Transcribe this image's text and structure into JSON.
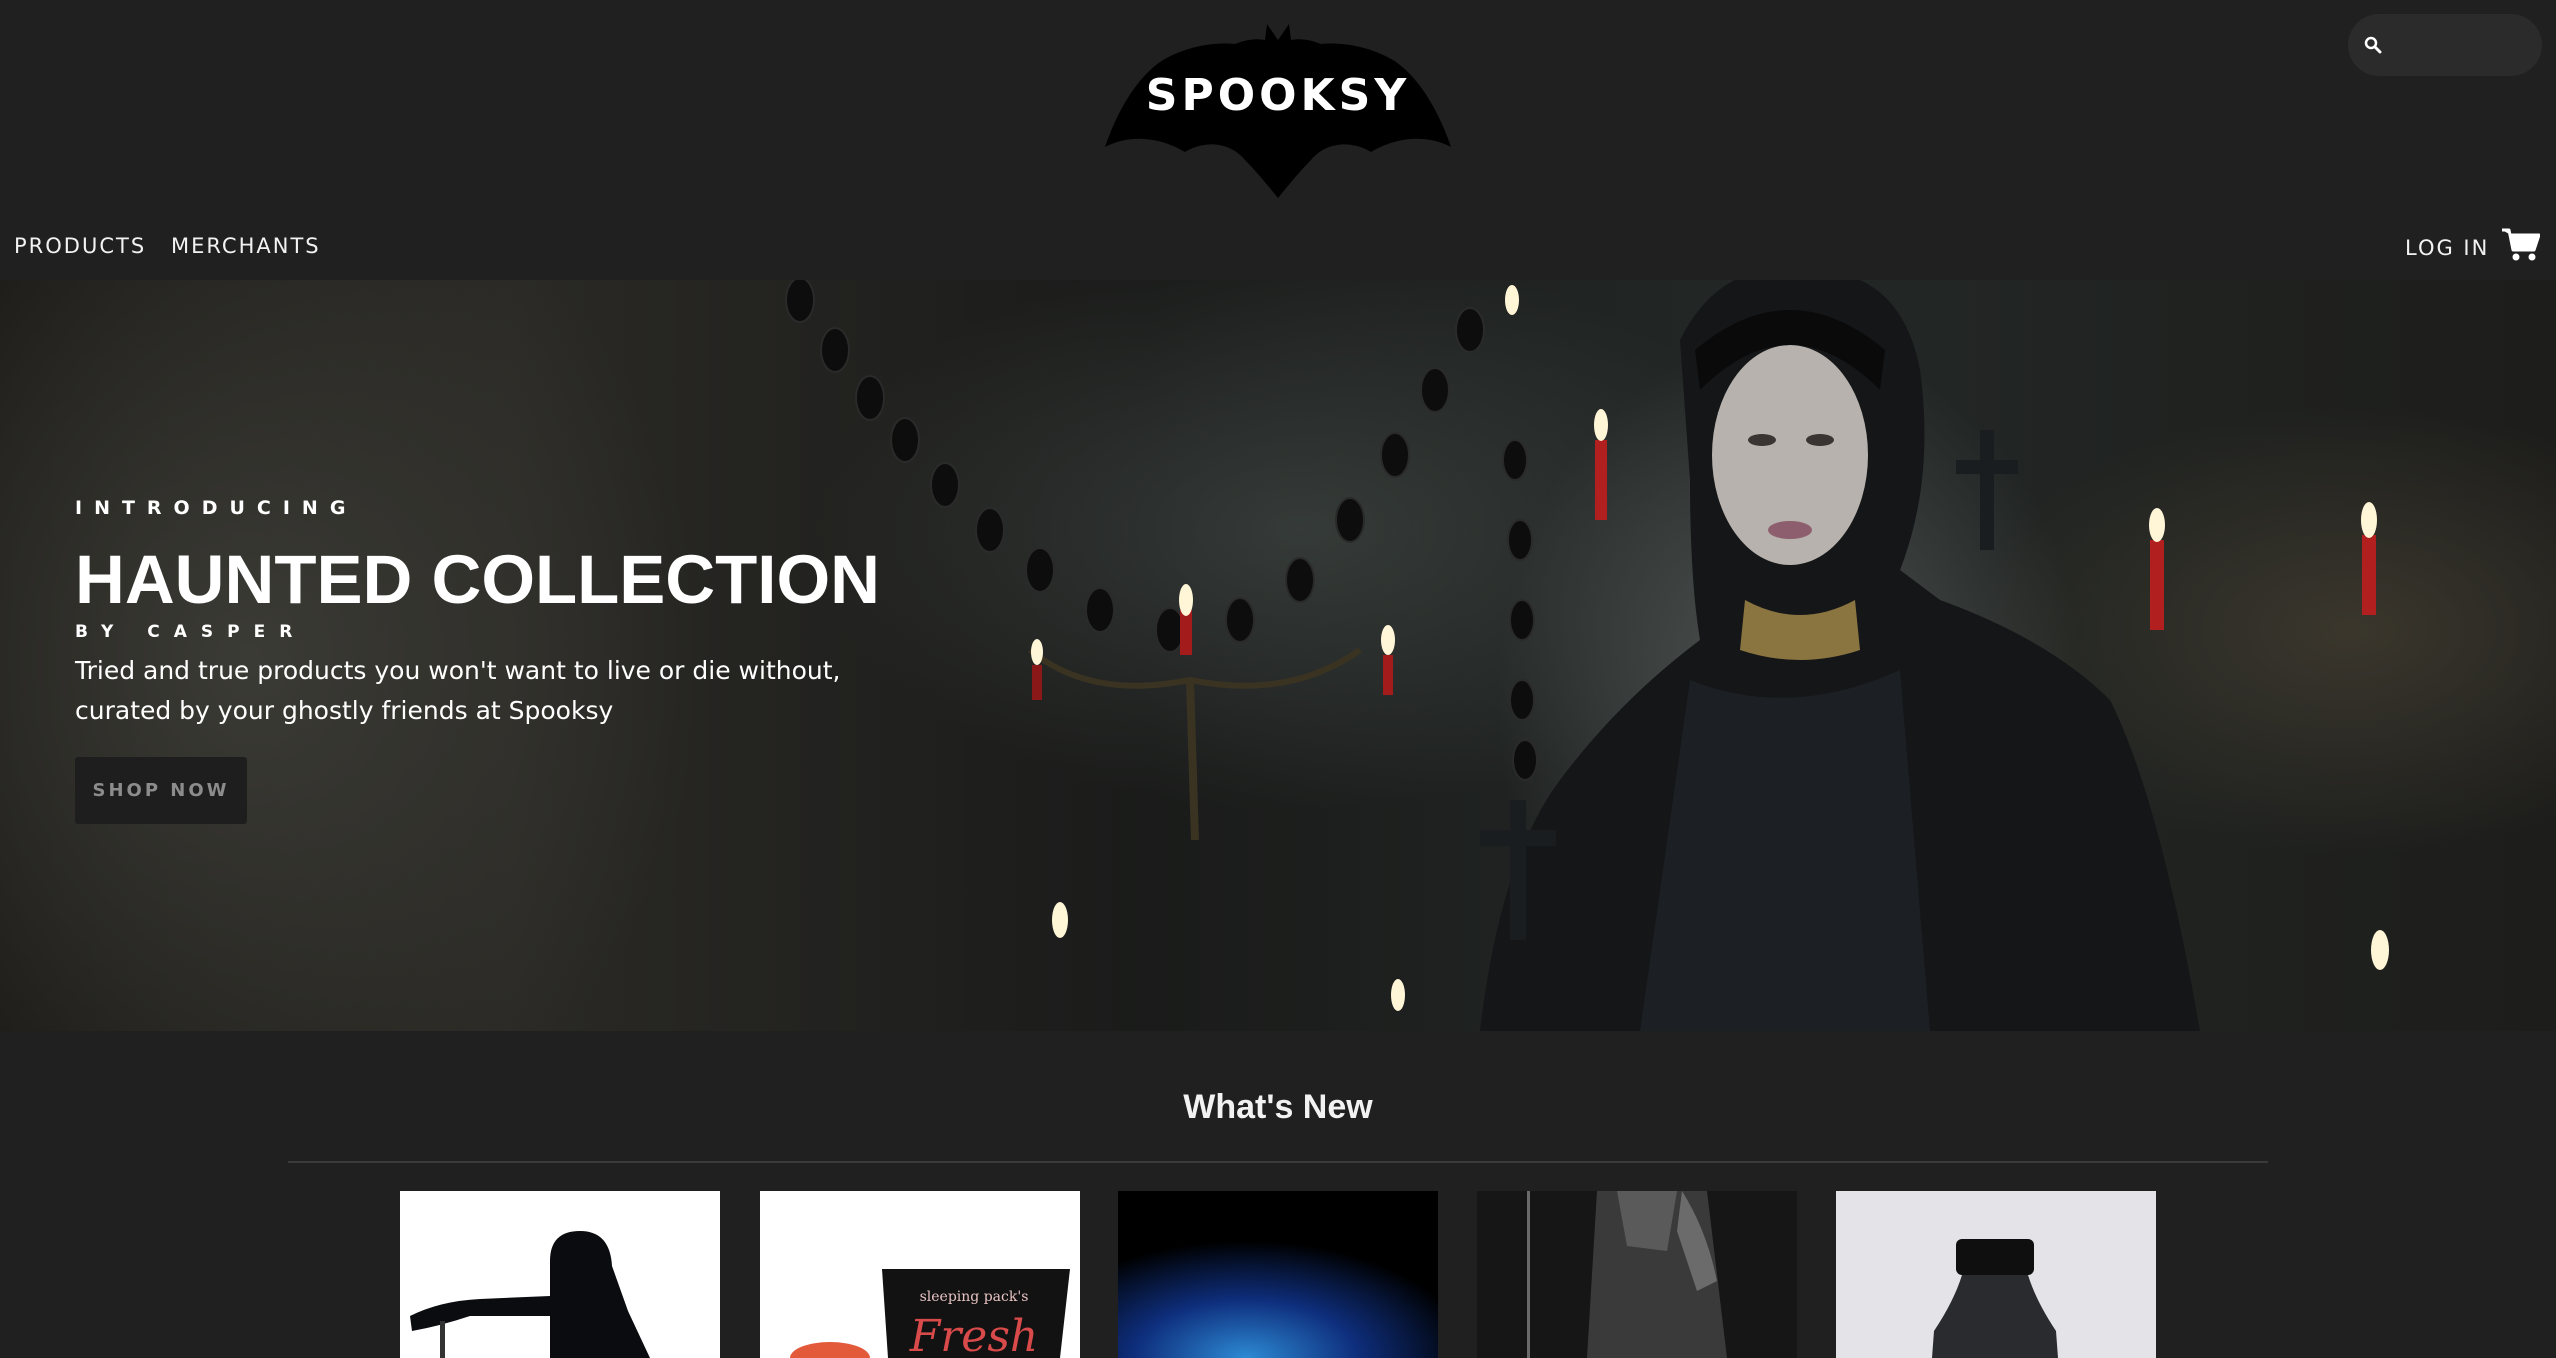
{
  "header": {
    "logo_text": "SPOOKSY",
    "search": {
      "placeholder": "",
      "value": ""
    },
    "nav": [
      {
        "label": "PRODUCTS"
      },
      {
        "label": "MERCHANTS"
      }
    ],
    "login_label": "LOG IN"
  },
  "hero": {
    "eyebrow": "INTRODUCING",
    "title": "HAUNTED COLLECTION",
    "byline": "BY CASPER",
    "tagline": "Tried and true products you won't want to live or die without, curated by your ghostly friends at Spooksy",
    "cta_label": "SHOP NOW"
  },
  "whats_new": {
    "title": "What's New",
    "products": [
      {
        "name": "hooded-figure-product",
        "image_hint": "hooded silhouette on white"
      },
      {
        "name": "sleeping-pack-product",
        "image_hint": "Sleeping pack tube on white"
      },
      {
        "name": "blue-smoke-product",
        "image_hint": "blue smoke on black"
      },
      {
        "name": "dark-figure-product",
        "image_hint": "dark grayscale figure"
      },
      {
        "name": "black-bottle-product",
        "image_hint": "black bottle on light gray"
      }
    ]
  },
  "colors": {
    "background": "#202020",
    "text": "#ffffff",
    "button_bg": "#1e1e1e",
    "button_text": "#8c8c8c",
    "divider": "#3a3a3a"
  }
}
